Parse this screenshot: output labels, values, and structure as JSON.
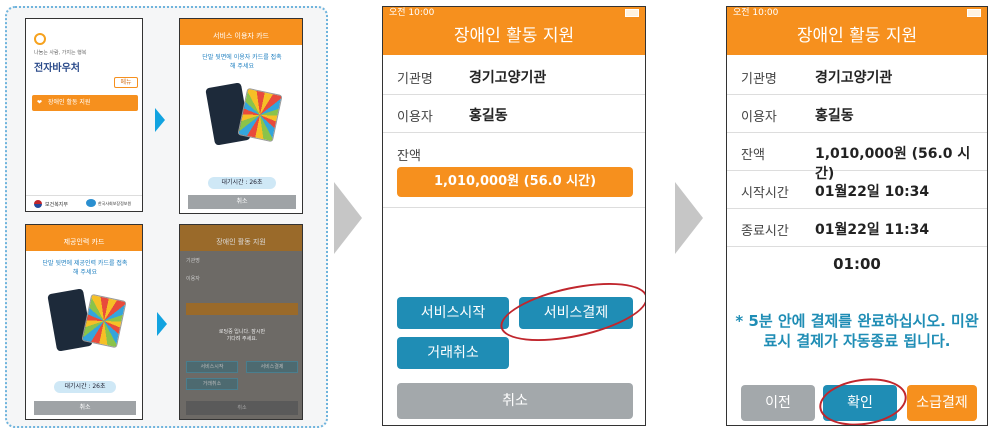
{
  "collage": {
    "s1": {
      "tagline": "나눔는 사람, 가지는 행복",
      "title": "전자바우처",
      "menu_label": "메뉴",
      "menu_btn": "장애인 활동 지원",
      "footer1": "보건복지부",
      "footer2": "한국사회보장정보원"
    },
    "s2": {
      "header": "서비스 이용자 카드",
      "instruction": "단말 뒷면에 이용자 카드를 접촉해 주세요",
      "wait": "대기시간 : 26초",
      "cancel": "취소"
    },
    "s3": {
      "header": "제공인력 카드",
      "instruction": "단말 뒷면에 제공인력 카드를 접촉해 주세요",
      "wait": "대기시간 : 26초",
      "cancel": "취소"
    },
    "s4": {
      "header": "장애인 활동 지원",
      "row1": "기관명",
      "row2": "이용자",
      "loading": "로딩중 입니다. 잠시만 기다려 주세요.",
      "btn1": "서비스시작",
      "btn2": "서비스결제",
      "btn3": "거래취소",
      "cancel": "취소"
    }
  },
  "screen_a": {
    "status_time": "오전 10:00",
    "title": "장애인 활동 지원",
    "org_label": "기관명",
    "org_value": "경기고양기관",
    "user_label": "이용자",
    "user_value": "홍길동",
    "balance_label": "잔액",
    "balance_value": "1,010,000원 (56.0 시간)",
    "start_btn": "서비스시작",
    "pay_btn": "서비스결제",
    "cancel_tx_btn": "거래취소",
    "cancel_btn": "취소"
  },
  "screen_b": {
    "status_time": "오전 10:00",
    "title": "장애인 활동 지원",
    "org_label": "기관명",
    "org_value": "경기고양기관",
    "user_label": "이용자",
    "user_value": "홍길동",
    "balance_label": "잔액",
    "balance_value": "1,010,000원 (56.0 시간)",
    "start_label": "시작시간",
    "start_value": "01월22일 10:34",
    "end_label": "종료시간",
    "end_value": "01월22일 11:34",
    "duration": "01:00",
    "notice": "* 5분 안에 결제를 완료하십시오. 미완료시 결제가 자동종료 됩니다.",
    "prev_btn": "이전",
    "confirm_btn": "확인",
    "retro_btn": "소급결제"
  },
  "colors": {
    "orange": "#f6901e",
    "teal": "#1f8db5",
    "gray": "#a3a8ab",
    "notice": "#1f8db5",
    "circle": "#c0262d"
  }
}
